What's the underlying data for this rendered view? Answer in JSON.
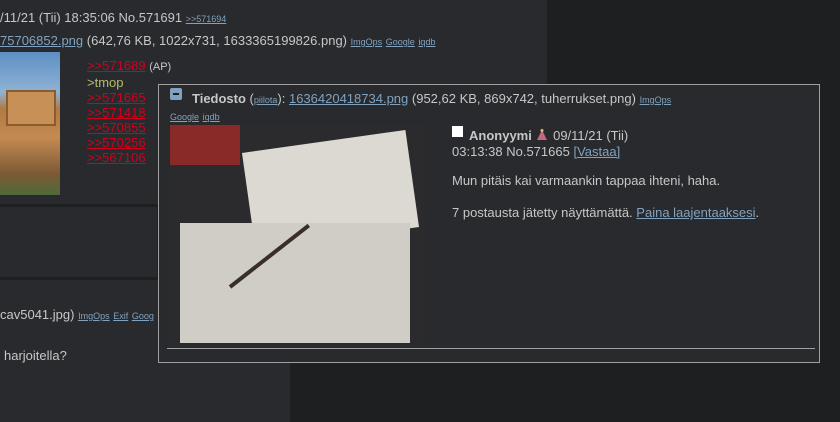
{
  "bg_post": {
    "header": "/11/21 (Tii) 18:35:06 No.571691",
    "header_link": ">>571694",
    "file_link": "75706852.png",
    "file_meta": "(642,76 KB, 1022x731, 1633365199826.png)",
    "tools": [
      "ImgOps",
      "Google",
      "iqdb"
    ],
    "backlinks": [
      ">>571689",
      ">>571665",
      ">>571418",
      ">>570855",
      ">>570256",
      ">>567106"
    ],
    "ap_label": "(AP)",
    "greentext": ">tmop",
    "cav_file": "cav5041.jpg)",
    "cav_tools": [
      "ImgOps",
      "Exif",
      "Goog"
    ],
    "harj_text": "harjoitella?"
  },
  "popup": {
    "file_label": "Tiedosto",
    "hide_label": "piilota",
    "file_link": "1636420418734.png",
    "file_meta": "(952,62 KB, 869x742, tuherrukset.png)",
    "tools": [
      "ImgOps",
      "Google",
      "iqdb"
    ],
    "name": "Anonyymi",
    "date": "09/11/21 (Tii)",
    "time_no": "03:13:38 No.571665",
    "reply_label": "[Vastaa]",
    "message": "Mun pitäis kai varmaankin tappaa ihteni, haha.",
    "omitted_text": "7 postausta jätetty näyttämättä.",
    "expand_link": "Paina laajentaaksesi",
    "expand_after": "."
  }
}
